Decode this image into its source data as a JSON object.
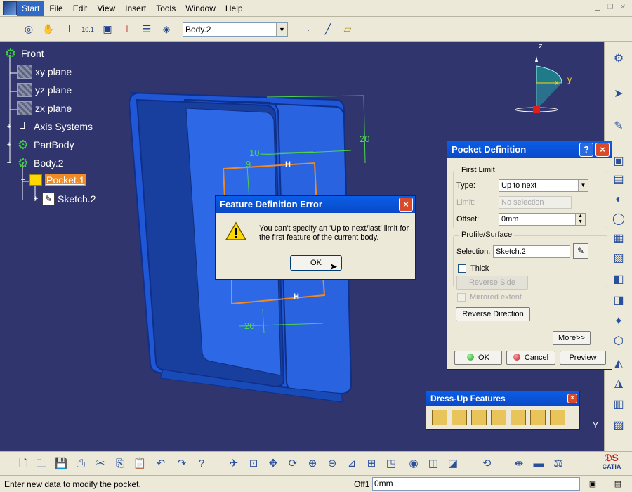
{
  "menu": {
    "items": [
      "Start",
      "File",
      "Edit",
      "View",
      "Insert",
      "Tools",
      "Window",
      "Help"
    ],
    "active": "Start"
  },
  "toolbar": {
    "body_select_value": "Body.2"
  },
  "tree": {
    "root": "Front",
    "xy_plane": "xy plane",
    "yz_plane": "yz plane",
    "zx_plane": "zx plane",
    "axis_systems": "Axis Systems",
    "part_body": "PartBody",
    "body2": "Body.2",
    "pocket1": "Pocket.1",
    "sketch2": "Sketch.2"
  },
  "viewport": {
    "dim_top": "20",
    "dim_bottom": "20",
    "dim_10": "10",
    "dim_9": "9",
    "h_marker_top": "H",
    "h_marker_bottom": "H",
    "compass_z": "z",
    "compass_x": "x",
    "compass_y": "y",
    "axis_y": "Y"
  },
  "error_dialog": {
    "title": "Feature Definition Error",
    "message": "You can't specify an 'Up to next/last' limit for the first feature of the current body.",
    "ok_label": "OK",
    "close_icon": "×"
  },
  "pocket_dialog": {
    "title": "Pocket Definition",
    "help_icon": "?",
    "close_icon": "×",
    "first_limit": {
      "group_label": "First Limit",
      "type_label": "Type:",
      "type_value": "Up to next",
      "limit_label": "Limit:",
      "limit_value": "No selection",
      "offset_label": "Offset:",
      "offset_value": "0mm"
    },
    "profile": {
      "group_label": "Profile/Surface",
      "selection_label": "Selection:",
      "selection_value": "Sketch.2",
      "thick_label": "Thick",
      "reverse_side_label": "Reverse Side"
    },
    "mirrored_label": "Mirrored extent",
    "reverse_direction_label": "Reverse Direction",
    "more_label": "More>>",
    "ok_label": "OK",
    "cancel_label": "Cancel",
    "preview_label": "Preview"
  },
  "dressup": {
    "title": "Dress-Up Features",
    "close_icon": "×"
  },
  "status": {
    "message": "Enter new data to modify the pocket.",
    "field_label": "Off1",
    "field_value": "0mm"
  },
  "brand": {
    "text": "CATIA"
  },
  "colors": {
    "viewport_bg": "#31356e",
    "model_blue": "#1f57d6",
    "dim_green": "#4fd24f",
    "highlight_orange": "#f08a24",
    "title_blue": "#0b53d8"
  }
}
